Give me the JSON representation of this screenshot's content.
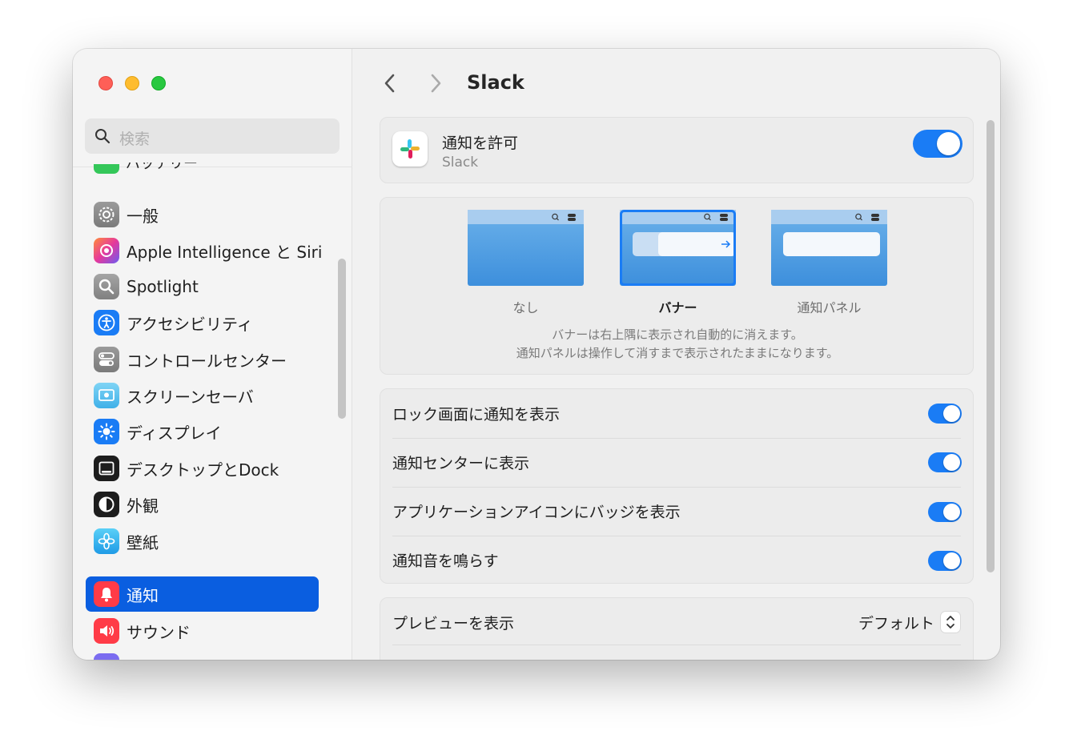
{
  "search": {
    "placeholder": "検索"
  },
  "sidebar": {
    "partial_top_label": "バッテリー",
    "items": [
      {
        "label": "一般",
        "icon": "gear-icon"
      },
      {
        "label": "Apple Intelligence と Siri",
        "icon": "siri-icon"
      },
      {
        "label": "Spotlight",
        "icon": "magnifier-icon"
      },
      {
        "label": "アクセシビリティ",
        "icon": "accessibility-icon"
      },
      {
        "label": "コントロールセンター",
        "icon": "control-center-icon"
      },
      {
        "label": "スクリーンセーバ",
        "icon": "screensaver-icon"
      },
      {
        "label": "ディスプレイ",
        "icon": "sun-icon"
      },
      {
        "label": "デスクトップとDock",
        "icon": "dock-icon"
      },
      {
        "label": "外観",
        "icon": "appearance-icon"
      },
      {
        "label": "壁紙",
        "icon": "flower-icon"
      },
      {
        "label": "通知",
        "icon": "bell-icon",
        "selected": true
      },
      {
        "label": "サウンド",
        "icon": "speaker-icon"
      }
    ]
  },
  "header": {
    "title": "Slack"
  },
  "allow": {
    "title": "通知を許可",
    "subtitle": "Slack",
    "enabled": true
  },
  "alert_style": {
    "options": [
      {
        "label": "なし",
        "selected": false
      },
      {
        "label": "バナー",
        "selected": true
      },
      {
        "label": "通知パネル",
        "selected": false
      }
    ],
    "description_1": "バナーは右上隅に表示され自動的に消えます。",
    "description_2": "通知パネルは操作して消すまで表示されたままになります。"
  },
  "toggles": [
    {
      "label": "ロック画面に通知を表示",
      "enabled": true
    },
    {
      "label": "通知センターに表示",
      "enabled": true
    },
    {
      "label": "アプリケーションアイコンにバッジを表示",
      "enabled": true
    },
    {
      "label": "通知音を鳴らす",
      "enabled": true
    }
  ],
  "preview": {
    "label": "プレビューを表示",
    "value": "デフォルト"
  },
  "colors": {
    "accent": "#1a7cf5",
    "selected_sidebar": "#0a5ee0"
  }
}
